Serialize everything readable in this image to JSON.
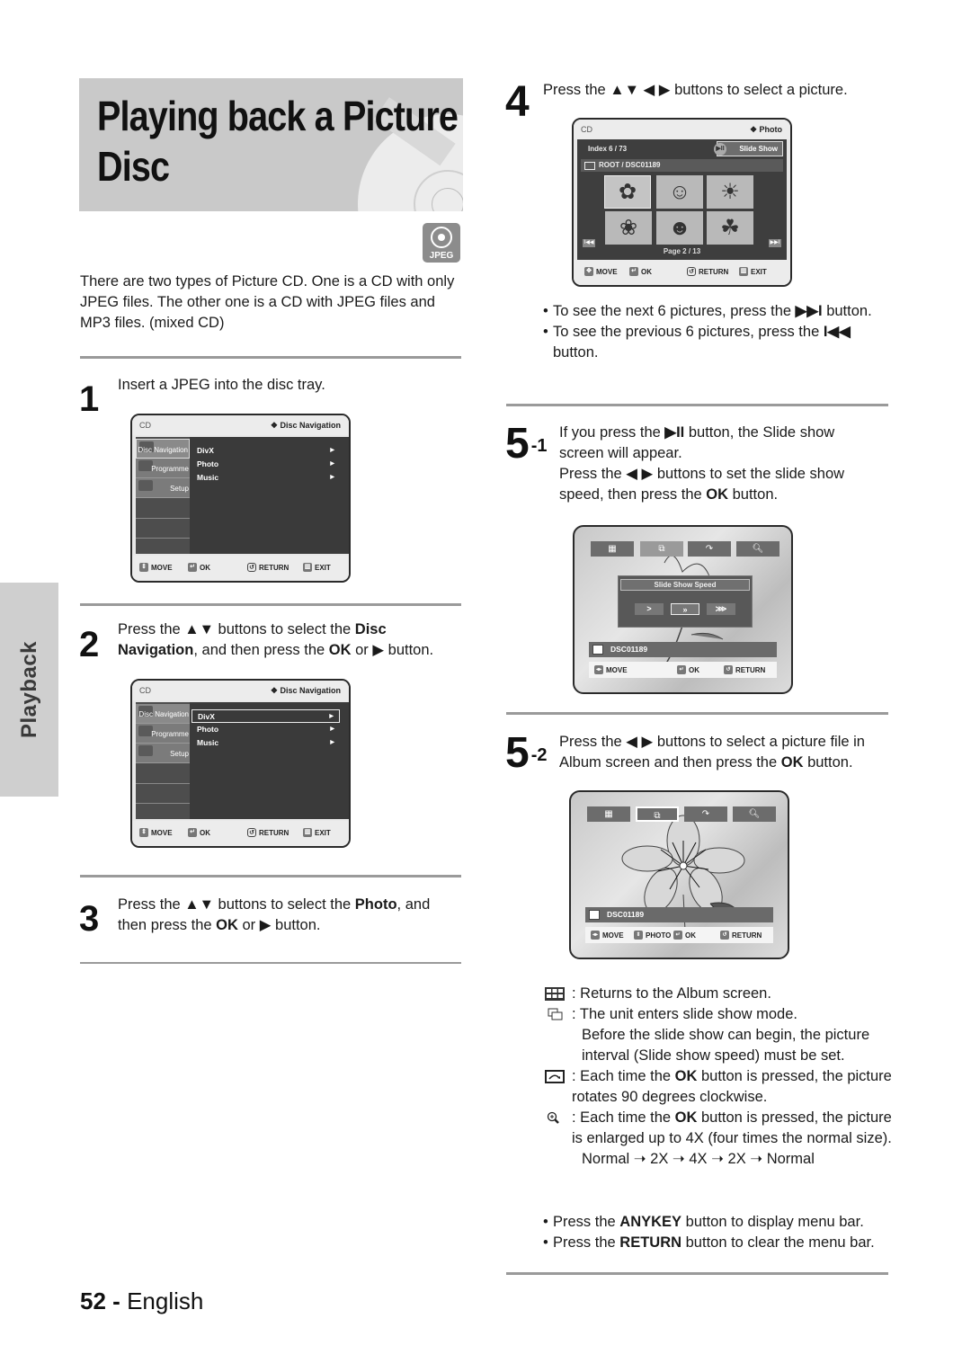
{
  "page": {
    "title": "Playing back a Picture Disc",
    "badge": "JPEG",
    "side_tab": "Playback",
    "intro": "There are two types of Picture CD. One is a CD with only JPEG files. The other one is a CD with JPEG files and MP3 files. (mixed CD)",
    "footer_number": "52",
    "footer_sep": "-",
    "footer_lang": "English"
  },
  "steps": {
    "s1": {
      "num": "1",
      "text": "Insert a JPEG into the disc tray."
    },
    "s2": {
      "num": "2",
      "pre": "Press the ▲▼ buttons to select the ",
      "bold1": "Disc Navigation",
      "mid": ", and then press the ",
      "bold2": "OK",
      "post": " or ▶ button."
    },
    "s3": {
      "num": "3",
      "pre": "Press the ▲▼ buttons to select the ",
      "bold1": "Photo",
      "mid": ", and then press the ",
      "bold2": "OK",
      "post": " or ▶ button."
    },
    "s4": {
      "num": "4",
      "text": "Press the ▲▼ ◀ ▶ buttons to select a picture."
    },
    "s51": {
      "num": "5",
      "sup": "-1",
      "l1a": "If you press the ",
      "l1b": "▶II",
      "l1c": " button, the Slide show screen will appear.",
      "l2": "Press the ◀ ▶ buttons to set the slide show speed, then press the ",
      "l2b": "OK",
      "l2c": " button."
    },
    "s52": {
      "num": "5",
      "sup": "-2",
      "pre": "Press the ◀ ▶ buttons to select a picture file in Album screen and then press the ",
      "bold": "OK",
      "post": " button."
    }
  },
  "osd_disc_nav": {
    "source": "CD",
    "title": "❖ Disc Navigation",
    "sidebar": [
      "Disc Navigation",
      "Programme",
      "Setup"
    ],
    "items": [
      "DivX",
      "Photo",
      "Music"
    ],
    "footer": {
      "move": "MOVE",
      "ok": "OK",
      "return": "RETURN",
      "exit": "EXIT"
    }
  },
  "osd_album": {
    "source": "CD",
    "title": "❖ Photo",
    "index": "Index   6 /     73",
    "slideshow": "Slide Show",
    "path": "ROOT / DSC01189",
    "thumbs": [
      "✿",
      "☺",
      "☀",
      "❀",
      "☻",
      "☘"
    ],
    "page": "Page   2   /     13",
    "footer": {
      "move": "MOVE",
      "ok": "OK",
      "return": "RETURN",
      "exit": "EXIT"
    }
  },
  "bullets_4": [
    {
      "pre": "To see the next 6 pictures, press the ",
      "bold": "▶▶I",
      "post": " button."
    },
    {
      "pre": "To see the previous 6 pictures, press the ",
      "bold": "I◀◀",
      "post": " button."
    }
  ],
  "osd_slideshow": {
    "speed_title": "Slide Show Speed",
    "speeds": [
      ">",
      "»",
      "⋙"
    ],
    "file": "DSC01189",
    "footer": {
      "move": "MOVE",
      "ok": "OK",
      "return": "RETURN"
    }
  },
  "osd_photo": {
    "file": "DSC01189",
    "footer": {
      "move": "MOVE",
      "photo": "PHOTO",
      "ok": "OK",
      "return": "RETURN"
    }
  },
  "legend": {
    "album": ": Returns to the Album screen.",
    "slideshow": ": The unit enters slide show mode.",
    "slideshow_cont": "Before the slide show can begin, the picture interval (Slide show speed) must be set.",
    "rotate_pre": ": Each time the ",
    "rotate_bold": "OK",
    "rotate_post": " button is pressed, the picture rotates 90 degrees clockwise.",
    "zoom_pre": ": Each time the ",
    "zoom_bold": "OK",
    "zoom_post": " button is pressed, the picture is enlarged up to 4X (four times the normal size).",
    "zoom_seq": "Normal ➝ 2X ➝ 4X ➝ 2X ➝ Normal"
  },
  "bullets_end": [
    {
      "pre": "Press the ",
      "bold": "ANYKEY",
      "post": " button to display menu bar."
    },
    {
      "pre": "Press the ",
      "bold": "RETURN",
      "post": " button to clear the menu bar."
    }
  ]
}
